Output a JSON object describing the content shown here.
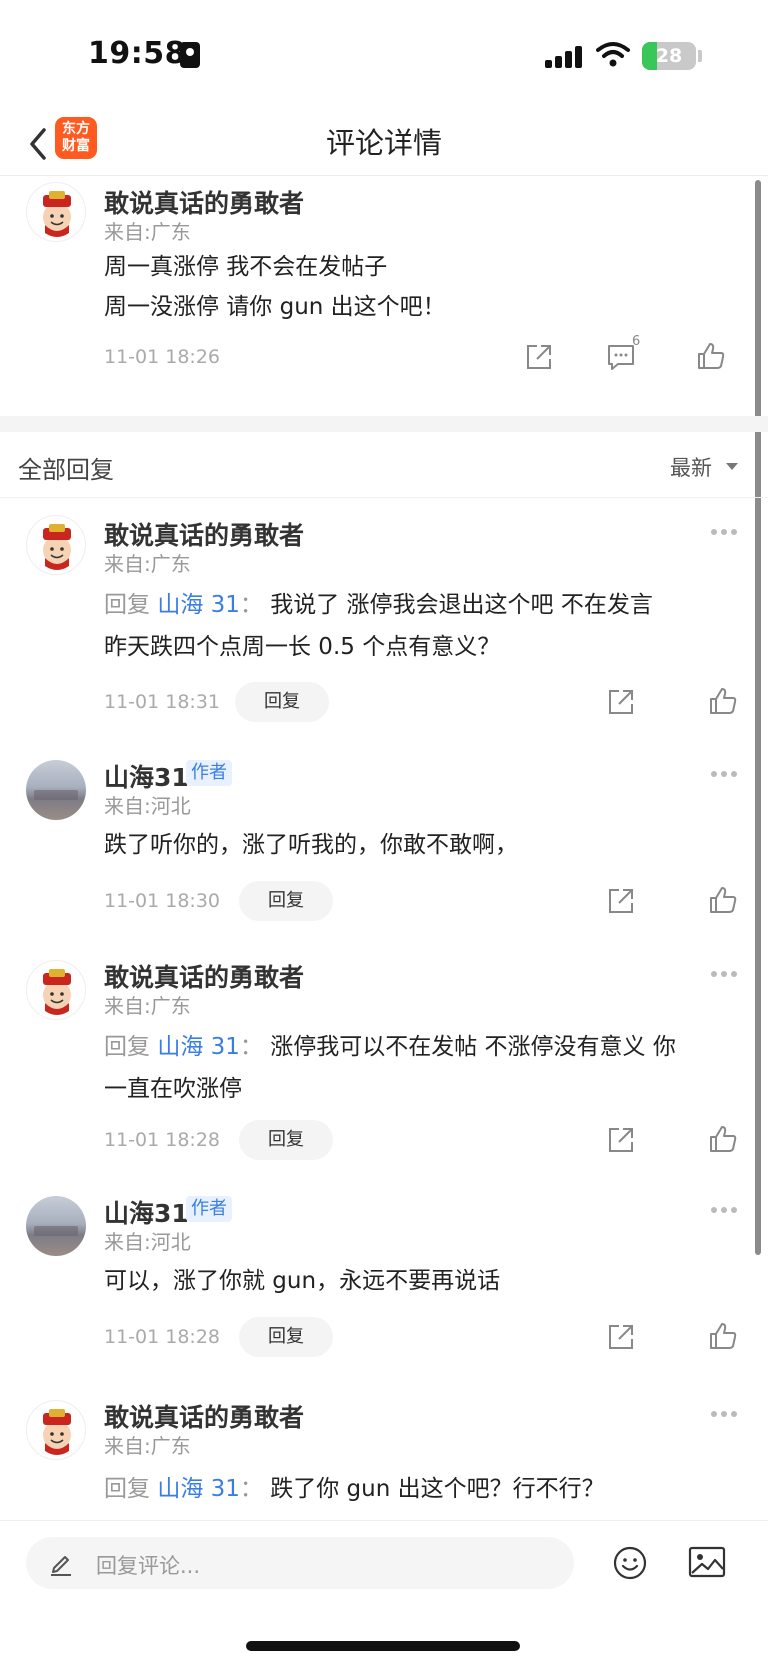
{
  "status_bar": {
    "time": "19:58",
    "battery": "28",
    "battery_level": 0.28
  },
  "nav": {
    "title": "评论详情",
    "logo_top": "东方",
    "logo_bottom": "财富"
  },
  "main_comment": {
    "user": "敢说真话的勇敢者",
    "location": "来自:广东",
    "line1": "周一真涨停 我不会在发帖子",
    "line2": "周一没涨停 请你 gun 出这个吧！",
    "time": "11-01 18:26",
    "comment_count": "6"
  },
  "list_header": {
    "title": "全部回复",
    "sort": "最新"
  },
  "replies": [
    {
      "user": "敢说真话的勇敢者",
      "location": "来自:广东",
      "reply_prefix": "回复",
      "reply_to": "山海 31",
      "colon": "：",
      "line1": "我说了 涨停我会退出这个吧 不在发言",
      "line2": "昨天跌四个点周一长 0.5 个点有意义？",
      "time": "11-01 18:31",
      "reply_label": "回复"
    },
    {
      "user": "山海31",
      "badge": "作者",
      "location": "来自:河北",
      "line1": "跌了听你的，涨了听我的，你敢不敢啊，",
      "time": "11-01 18:30",
      "reply_label": "回复"
    },
    {
      "user": "敢说真话的勇敢者",
      "location": "来自:广东",
      "reply_prefix": "回复",
      "reply_to": "山海 31",
      "colon": "：",
      "line1": "涨停我可以不在发帖  不涨停没有意义 你",
      "line2": "一直在吹涨停",
      "time": "11-01 18:28",
      "reply_label": "回复"
    },
    {
      "user": "山海31",
      "badge": "作者",
      "location": "来自:河北",
      "line1": "可以，涨了你就 gun，永远不要再说话",
      "time": "11-01 18:28",
      "reply_label": "回复"
    },
    {
      "user": "敢说真话的勇敢者",
      "location": "来自:广东",
      "reply_prefix": "回复",
      "reply_to": "山海 31",
      "colon": "：",
      "line1": "跌了你 gun 出这个吧？行不行？"
    }
  ],
  "bottom_bar": {
    "placeholder": "回复评论..."
  },
  "colors": {
    "accent": "#3a7ee4",
    "logo": "#ff5a1f",
    "battery": "#3ac75a"
  }
}
